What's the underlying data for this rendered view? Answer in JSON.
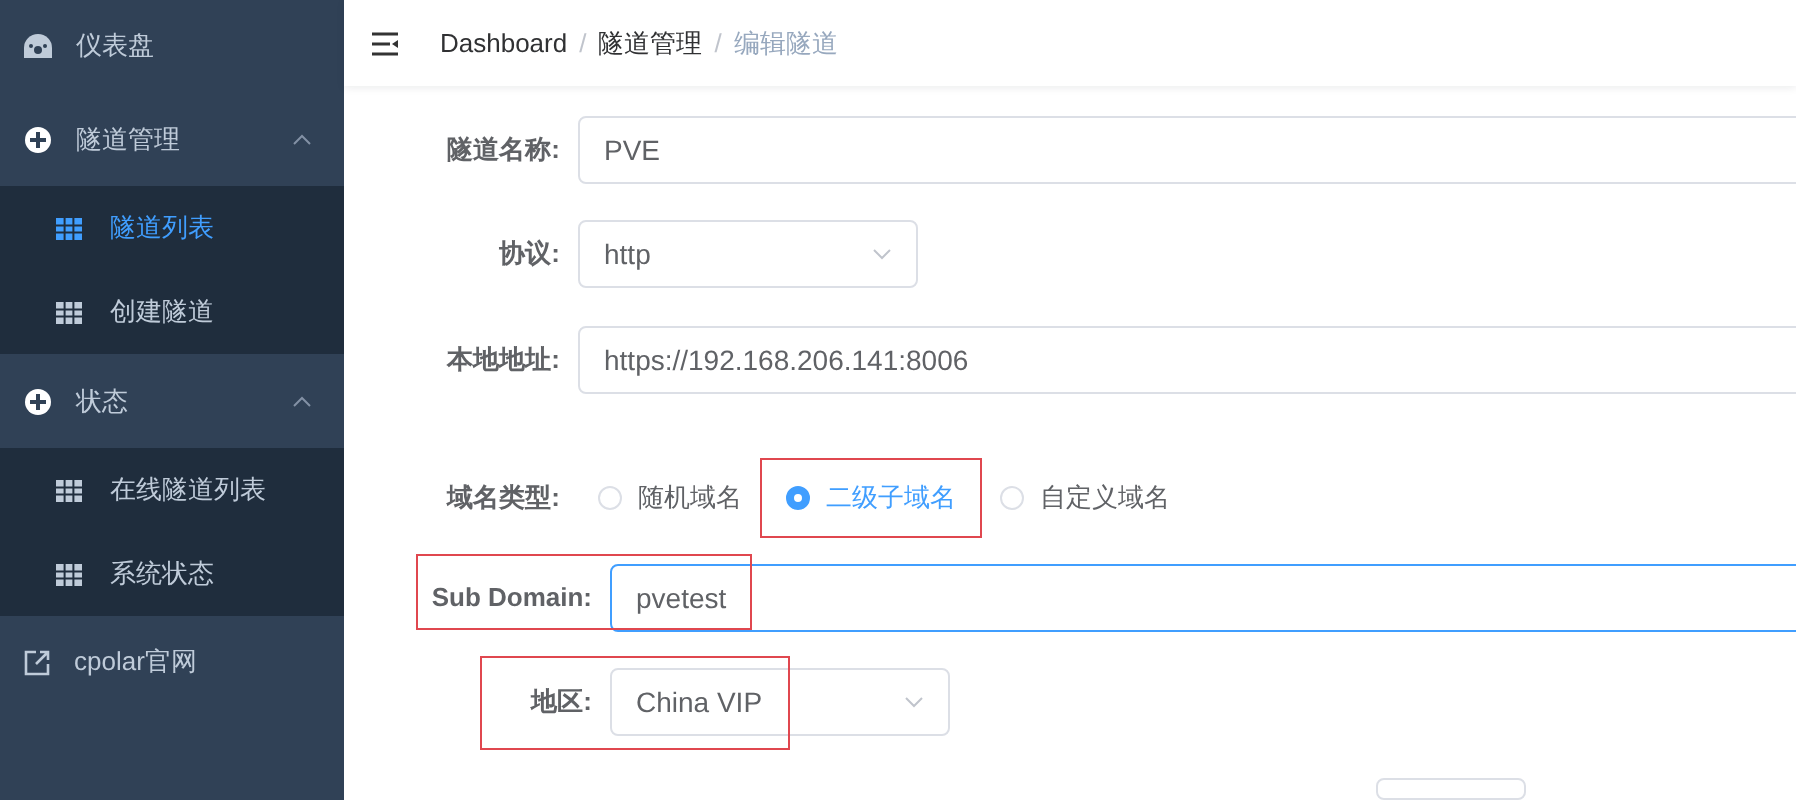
{
  "sidebar": {
    "items": [
      {
        "kind": "dashboard",
        "label": "仪表盘"
      },
      {
        "kind": "group",
        "label": "隧道管理",
        "expanded": true,
        "children": [
          {
            "label": "隧道列表",
            "selected": true
          },
          {
            "label": "创建隧道",
            "selected": false
          }
        ]
      },
      {
        "kind": "group",
        "label": "状态",
        "expanded": true,
        "children": [
          {
            "label": "在线隧道列表",
            "selected": false
          },
          {
            "label": "系统状态",
            "selected": false
          }
        ]
      },
      {
        "kind": "external",
        "label": "cpolar官网"
      }
    ]
  },
  "breadcrumb": [
    {
      "kind": "link",
      "text": "Dashboard"
    },
    {
      "kind": "separator",
      "text": "/"
    },
    {
      "kind": "link",
      "text": "隧道管理"
    },
    {
      "kind": "separator",
      "text": "/"
    },
    {
      "kind": "current",
      "text": "编辑隧道"
    }
  ],
  "form": {
    "fields": [
      {
        "kind": "text",
        "label": "隧道名称:",
        "value": "PVE"
      },
      {
        "kind": "select",
        "label": "协议:",
        "value": "http"
      },
      {
        "kind": "text",
        "label": "本地地址:",
        "value": "https://192.168.206.141:8006"
      },
      {
        "kind": "radio",
        "label": "域名类型:",
        "options": [
          {
            "label": "随机域名",
            "selected": false,
            "highlighted": false
          },
          {
            "label": "二级子域名",
            "selected": true,
            "highlighted": true
          },
          {
            "label": "自定义域名",
            "selected": false,
            "highlighted": false
          }
        ]
      },
      {
        "kind": "text",
        "label": "Sub Domain:",
        "value": "pvetest",
        "focused": true,
        "highlighted": true
      },
      {
        "kind": "select",
        "label": "地区:",
        "value": "China VIP",
        "highlighted": true
      }
    ]
  }
}
